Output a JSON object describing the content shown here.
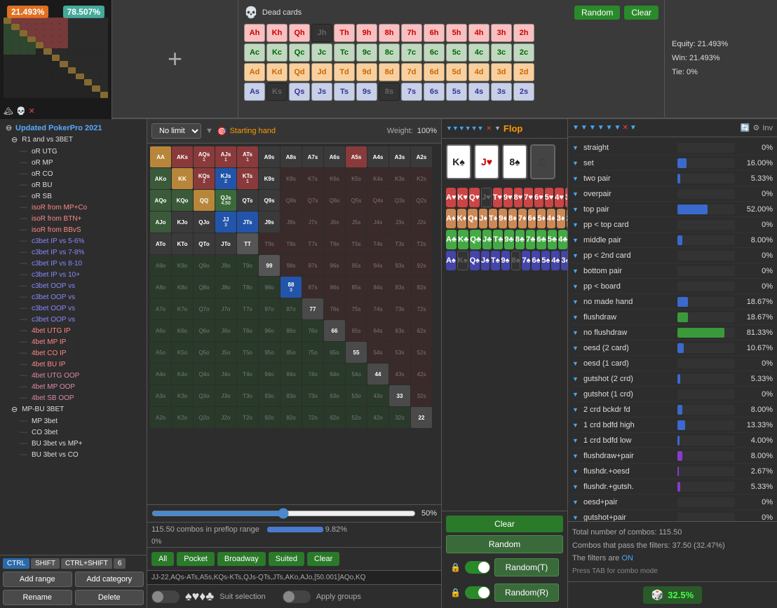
{
  "header": {
    "range1_pct": "21.493%",
    "range2_pct": "78.507%",
    "dead_cards_title": "Dead cards",
    "btn_random": "Random",
    "btn_clear": "Clear",
    "equity_label": "Equity: 21.493%",
    "win_label": "Win: 21.493%",
    "tie_label": "Tie: 0%"
  },
  "toolbar": {
    "game_type": "No limit",
    "starting_hand_label": "Starting hand",
    "weight_label": "Weight:",
    "weight_value": "100%"
  },
  "tree": {
    "title": "Updated PokerPro 2021",
    "items": [
      {
        "label": "R1 and vs 3BET",
        "level": 1,
        "color": "white"
      },
      {
        "label": "oR UTG",
        "level": 2,
        "color": "white"
      },
      {
        "label": "oR MP",
        "level": 2,
        "color": "white"
      },
      {
        "label": "oR CO",
        "level": 2,
        "color": "white"
      },
      {
        "label": "oR BU",
        "level": 2,
        "color": "white"
      },
      {
        "label": "oR SB",
        "level": 2,
        "color": "white"
      },
      {
        "label": "isoR from MP+Co",
        "level": 2,
        "color": "red"
      },
      {
        "label": "isoR from BTN+",
        "level": 2,
        "color": "red"
      },
      {
        "label": "isoR from BBvS",
        "level": 2,
        "color": "red"
      },
      {
        "label": "c3bet IP vs 5-6%",
        "level": 2,
        "color": "blue"
      },
      {
        "label": "c3bet IP vs 7-8%",
        "level": 2,
        "color": "blue"
      },
      {
        "label": "c3bet IP vs 8-10",
        "level": 2,
        "color": "blue"
      },
      {
        "label": "c3bet IP vs 10+",
        "level": 2,
        "color": "blue"
      },
      {
        "label": "c3bet OOP vs",
        "level": 2,
        "color": "blue"
      },
      {
        "label": "c3bet OOP vs",
        "level": 2,
        "color": "blue"
      },
      {
        "label": "c3bet OOP vs",
        "level": 2,
        "color": "blue"
      },
      {
        "label": "c3bet OOP vs",
        "level": 2,
        "color": "blue"
      },
      {
        "label": "4bet UTG IP",
        "level": 2,
        "color": "red"
      },
      {
        "label": "4bet MP IP",
        "level": 2,
        "color": "red"
      },
      {
        "label": "4bet CO IP",
        "level": 2,
        "color": "red"
      },
      {
        "label": "4bet BU IP",
        "level": 2,
        "color": "red"
      },
      {
        "label": "4bet UTG OOP",
        "level": 2,
        "color": "purple"
      },
      {
        "label": "4bet MP OOP",
        "level": 2,
        "color": "purple"
      },
      {
        "label": "4bet SB OOP",
        "level": 2,
        "color": "purple"
      },
      {
        "label": "MP-BU 3BET",
        "level": 1,
        "color": "white"
      },
      {
        "label": "MP 3bet",
        "level": 2,
        "color": "white"
      },
      {
        "label": "CO 3bet",
        "level": 2,
        "color": "white"
      },
      {
        "label": "BU 3bet vs MP+",
        "level": 2,
        "color": "white"
      },
      {
        "label": "BU 3bet vs CO",
        "level": 2,
        "color": "white"
      }
    ],
    "ctrl_btns": [
      "CTRL",
      "SHIFT",
      "CTRL+SHIFT",
      "6"
    ],
    "add_range": "Add range",
    "add_category": "Add category",
    "rename": "Rename",
    "delete": "Delete"
  },
  "matrix": {
    "ranks": [
      "A",
      "K",
      "Q",
      "J",
      "T",
      "9",
      "8",
      "7",
      "6",
      "5",
      "4",
      "3",
      "2"
    ],
    "combos_label": "115.50 combos in preflop range",
    "pct": "9.82%",
    "slider_value": 50,
    "slider_pct_label": "50%",
    "hand_text": "JJ-22,AQs-ATs,A5s,KQs-KTs,QJs-QTs,JTs,AKo,AJo,[50.001]AQo,KQ",
    "buttons": {
      "all": "All",
      "pocket": "Pocket",
      "broadway": "Broadway",
      "suited": "Suited",
      "clear": "Clear"
    },
    "range_pct_zero": "0%"
  },
  "flop": {
    "title": "Flop",
    "cards": [
      {
        "rank": "K♠",
        "suit": "spade"
      },
      {
        "rank": "J♥",
        "suit": "heart"
      },
      {
        "rank": "8♠",
        "suit": "spade"
      }
    ],
    "grid_suits": [
      "h",
      "d",
      "c",
      "s"
    ],
    "grid_ranks": [
      "A",
      "K",
      "Q",
      "J",
      "T",
      "9",
      "8",
      "7",
      "6",
      "5",
      "4",
      "3",
      "2"
    ],
    "btn_clear": "Clear",
    "btn_random": "Random",
    "btn_random_t": "Random(T)",
    "btn_random_r": "Random(R)"
  },
  "stats": {
    "title": "Flop",
    "inv_label": "Inv",
    "items": [
      {
        "name": "straight",
        "value": "0%",
        "bar": 0,
        "color": "blue"
      },
      {
        "name": "set",
        "value": "16.00%",
        "bar": 16,
        "color": "blue"
      },
      {
        "name": "two pair",
        "value": "5.33%",
        "bar": 5.33,
        "color": "blue"
      },
      {
        "name": "overpair",
        "value": "0%",
        "bar": 0,
        "color": "blue"
      },
      {
        "name": "top pair",
        "value": "52.00%",
        "bar": 52,
        "color": "blue"
      },
      {
        "name": "pp < top card",
        "value": "0%",
        "bar": 0,
        "color": "blue"
      },
      {
        "name": "middle pair",
        "value": "8.00%",
        "bar": 8,
        "color": "blue"
      },
      {
        "name": "pp < 2nd card",
        "value": "0%",
        "bar": 0,
        "color": "blue"
      },
      {
        "name": "bottom pair",
        "value": "0%",
        "bar": 0,
        "color": "blue"
      },
      {
        "name": "pp < board",
        "value": "0%",
        "bar": 0,
        "color": "blue"
      },
      {
        "name": "no made hand",
        "value": "18.67%",
        "bar": 18.67,
        "color": "blue"
      },
      {
        "name": "flushdraw",
        "value": "18.67%",
        "bar": 18.67,
        "color": "green"
      },
      {
        "name": "no flushdraw",
        "value": "81.33%",
        "bar": 81.33,
        "color": "green"
      },
      {
        "name": "oesd (2 card)",
        "value": "10.67%",
        "bar": 10.67,
        "color": "blue"
      },
      {
        "name": "oesd (1 card)",
        "value": "0%",
        "bar": 0,
        "color": "blue"
      },
      {
        "name": "gutshot (2 crd)",
        "value": "5.33%",
        "bar": 5.33,
        "color": "blue"
      },
      {
        "name": "gutshot (1 crd)",
        "value": "0%",
        "bar": 0,
        "color": "blue"
      },
      {
        "name": "2 crd bckdr fd",
        "value": "8.00%",
        "bar": 8,
        "color": "blue"
      },
      {
        "name": "1 crd bdfd high",
        "value": "13.33%",
        "bar": 13.33,
        "color": "blue"
      },
      {
        "name": "1 crd bdfd low",
        "value": "4.00%",
        "bar": 4,
        "color": "blue"
      },
      {
        "name": "flushdraw+pair",
        "value": "8.00%",
        "bar": 8,
        "color": "purple"
      },
      {
        "name": "flushdr.+oesd",
        "value": "2.67%",
        "bar": 2.67,
        "color": "purple"
      },
      {
        "name": "flushdr.+gutsh.",
        "value": "5.33%",
        "bar": 5.33,
        "color": "purple"
      },
      {
        "name": "oesd+pair",
        "value": "0%",
        "bar": 0,
        "color": "blue"
      },
      {
        "name": "gutshot+pair",
        "value": "0%",
        "bar": 0,
        "color": "blue"
      }
    ],
    "total_combos": "Total number of combos: 115.50",
    "pass_filter": "Combos that pass the filters: 37.50 (32.47%)",
    "filter_on": "The filters are ON",
    "tab_hint": "Press TAB for combo mode"
  },
  "pf_badge": {
    "icon": "🎲",
    "value": "32.5%"
  },
  "dead_cards_grid": {
    "rows": [
      [
        "Ah",
        "Kh",
        "Qh",
        "Jh",
        "Th",
        "9h",
        "8h",
        "7h",
        "6h",
        "5h",
        "4h",
        "3h",
        "2h"
      ],
      [
        "Ac",
        "Kc",
        "Qc",
        "Jc",
        "Tc",
        "9c",
        "8c",
        "7c",
        "6c",
        "5c",
        "4c",
        "3c",
        "2c"
      ],
      [
        "Ad",
        "Kd",
        "Qd",
        "Jd",
        "Td",
        "9d",
        "8d",
        "7d",
        "6d",
        "5d",
        "4d",
        "3d",
        "2d"
      ],
      [
        "As",
        "Ks",
        "Qs",
        "Js",
        "Ts",
        "9s",
        "8s",
        "7s",
        "6s",
        "5s",
        "4s",
        "3s",
        "2s"
      ]
    ],
    "suits": [
      "h",
      "h",
      "h",
      "h",
      "h",
      "h",
      "h",
      "h",
      "h",
      "h",
      "h",
      "h",
      "h",
      "c",
      "c",
      "c",
      "c",
      "c",
      "c",
      "c",
      "c",
      "c",
      "c",
      "c",
      "c",
      "c",
      "d",
      "d",
      "d",
      "d",
      "d",
      "d",
      "d",
      "d",
      "d",
      "d",
      "d",
      "d",
      "d",
      "s",
      "s",
      "s",
      "s",
      "s",
      "s",
      "s",
      "s",
      "s",
      "s",
      "s",
      "s",
      "s"
    ]
  }
}
